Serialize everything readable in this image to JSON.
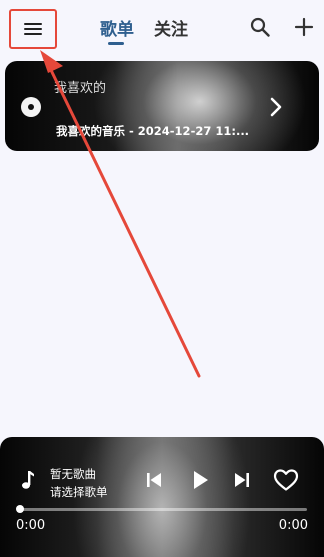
{
  "header": {
    "tabs": [
      {
        "label": "歌单",
        "active": true
      },
      {
        "label": "关注",
        "active": false
      }
    ],
    "menu_icon": "menu-icon",
    "search_icon": "search-icon",
    "add_icon": "add-icon",
    "accent_color": "#2f5f8f",
    "highlight_color": "#e5483a"
  },
  "favorite_card": {
    "title": "我喜欢的",
    "subtitle": "我喜欢的音乐 - 2024-12-27 11:...",
    "icon": "disc-icon",
    "chevron": "chevron-right-icon"
  },
  "player": {
    "song_title": "暂无歌曲",
    "song_subtitle": "请选择歌单",
    "current_time": "0:00",
    "total_time": "0:00",
    "progress": 0,
    "icons": [
      "music-note-icon",
      "skip-previous-icon",
      "play-icon",
      "skip-next-icon",
      "heart-icon"
    ]
  }
}
